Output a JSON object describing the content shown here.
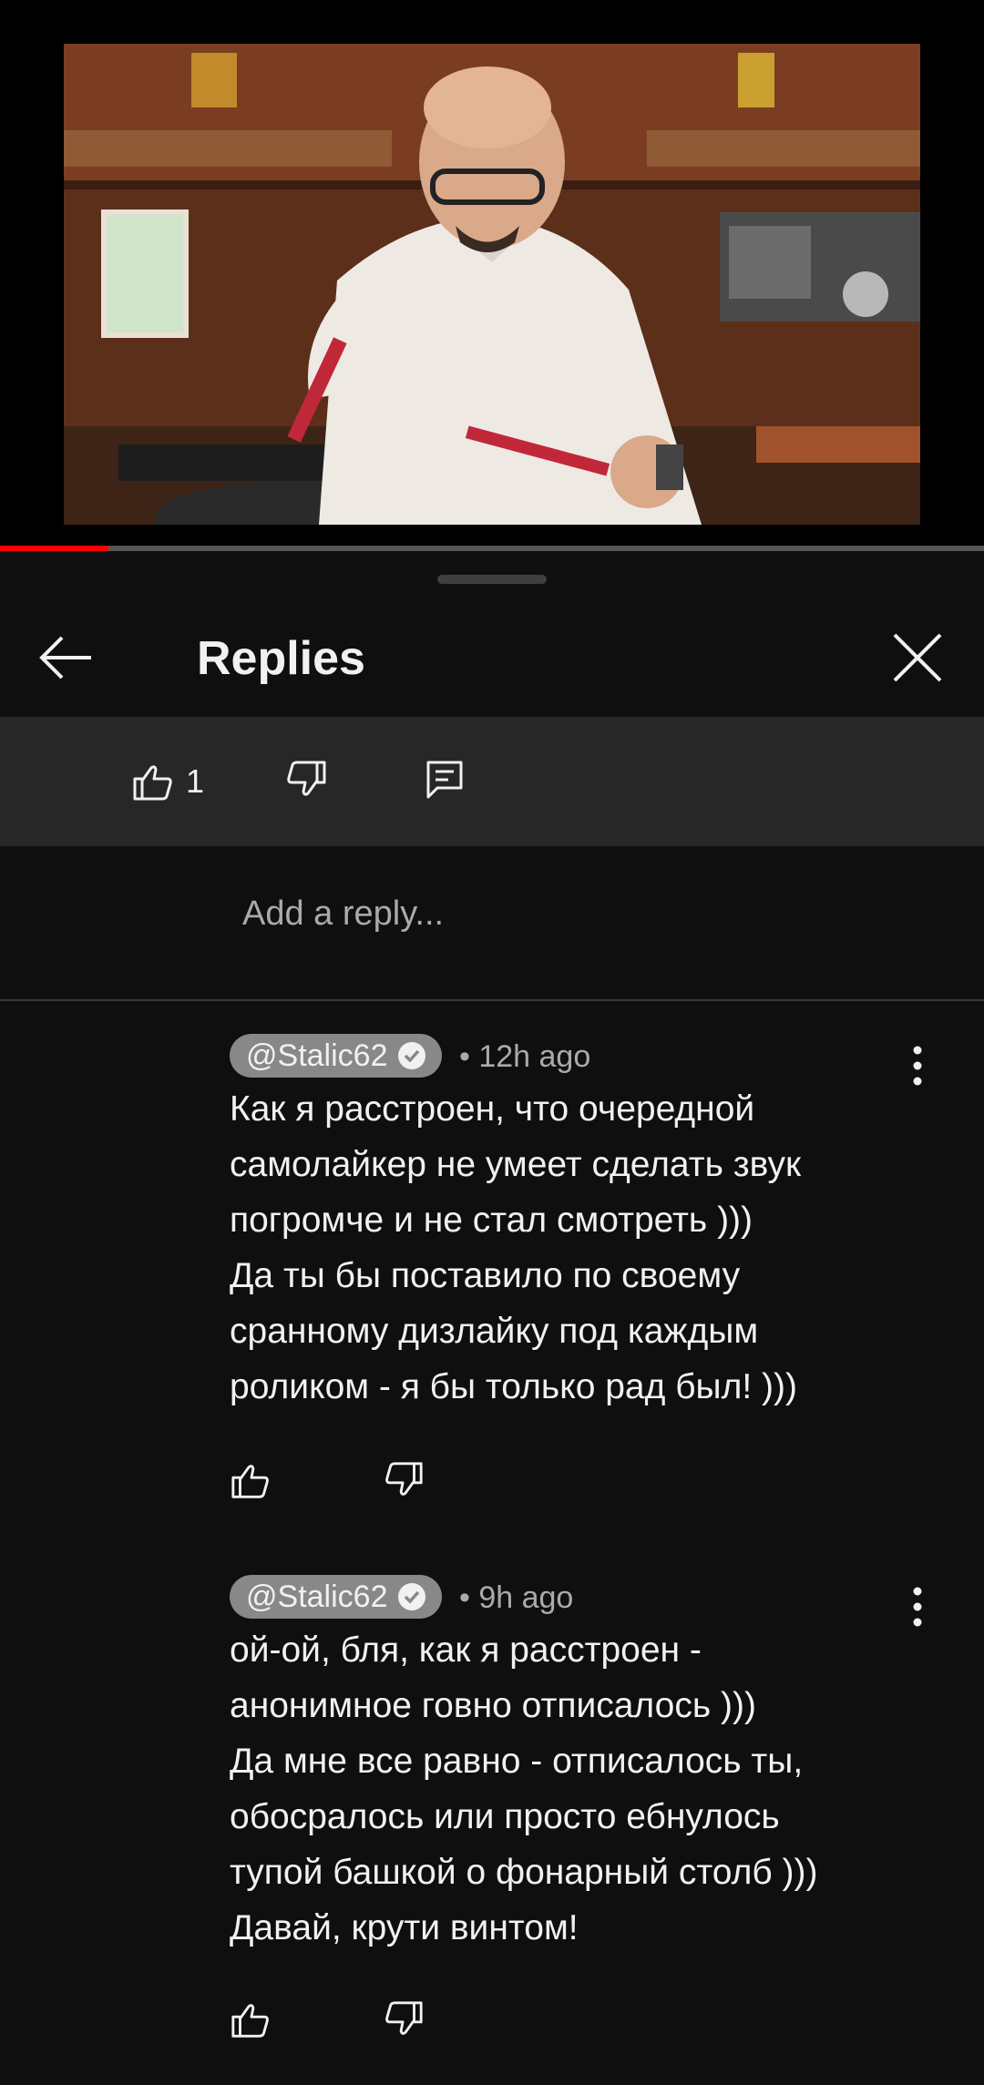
{
  "video": {
    "progress": 0.11
  },
  "sheet": {
    "title": "Replies"
  },
  "parent_comment": {
    "like_count": "1"
  },
  "reply_input": {
    "placeholder": "Add a reply..."
  },
  "replies": [
    {
      "author": "@Stalic62",
      "verified": true,
      "time": "• 12h ago",
      "text": "Как я расстроен, что очередной\nсамолайкер не умеет сделать звук\nпогромче и не стал смотреть )))\nДа ты бы поставило по своему\nсранному дизлайку под каждым\nроликом - я бы только рад был! )))"
    },
    {
      "author": "@Stalic62",
      "verified": true,
      "time": "• 9h ago",
      "text": "ой-ой, бля, как я расстроен -\nанонимное говно отписалось )))\nДа мне все равно - отписалось ты,\nобосралось или просто ебнулось\nтупой башкой о фонарный столб )))\nДавай, крути винтом!"
    }
  ],
  "colors": {
    "background": "#0f0f0f",
    "action_bar": "#272727",
    "progress": "#ff0000",
    "chip": "#888888"
  }
}
